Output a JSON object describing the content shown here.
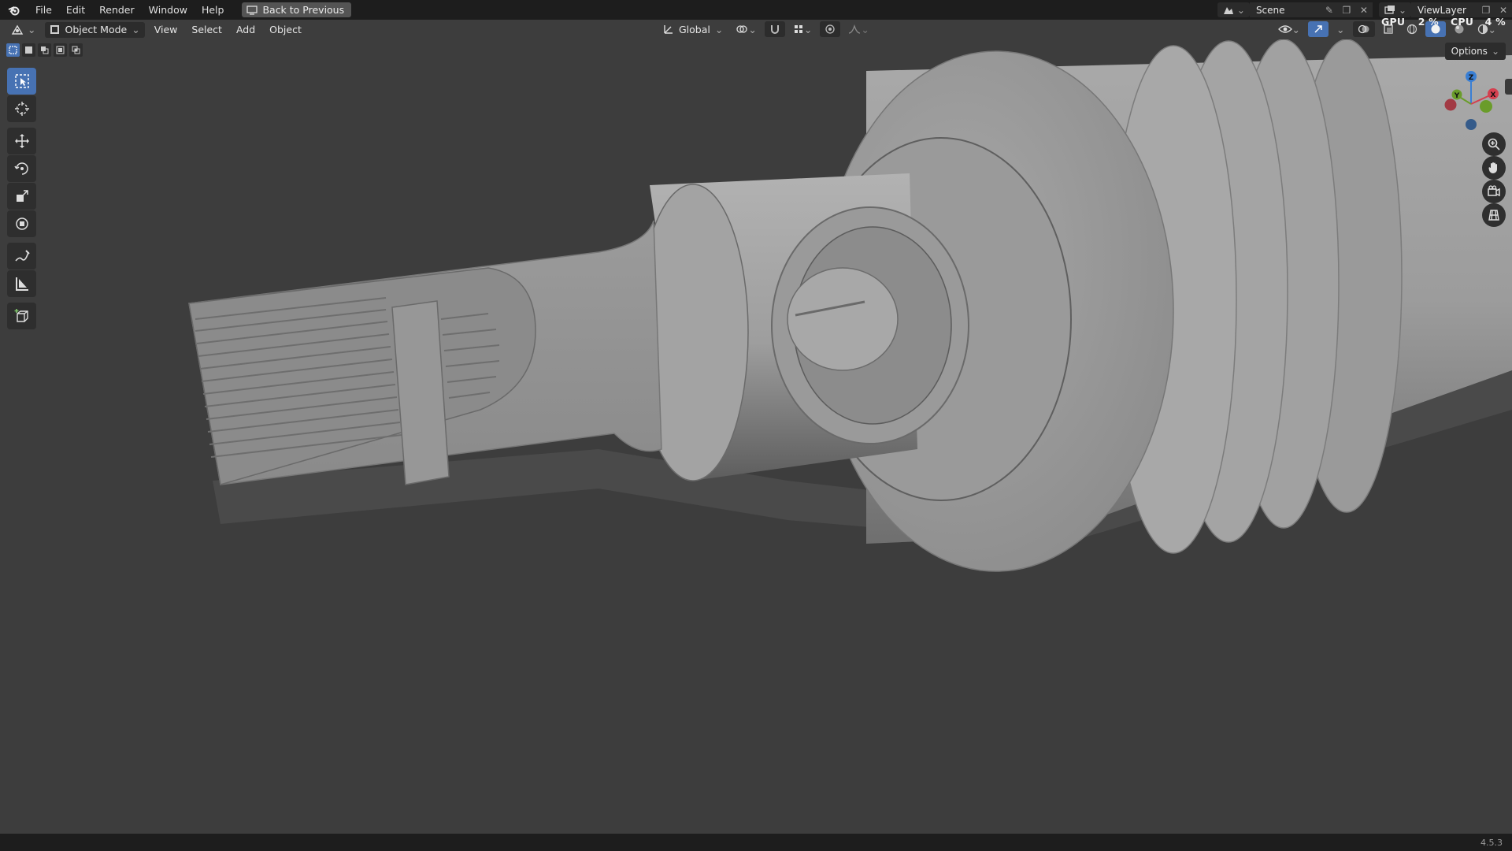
{
  "menu": {
    "items": [
      "File",
      "Edit",
      "Render",
      "Window",
      "Help"
    ],
    "back_label": "Back to Previous"
  },
  "scene": {
    "scene_name": "Scene",
    "view_layer": "ViewLayer"
  },
  "header": {
    "mode": "Object Mode",
    "menus": [
      "View",
      "Select",
      "Add",
      "Object"
    ],
    "orientation": "Global"
  },
  "perf": {
    "gpu_label": "GPU",
    "gpu_value": "2 %",
    "cpu_label": "CPU",
    "cpu_value": "4 %"
  },
  "options_label": "Options",
  "gizmo": {
    "x": "X",
    "y": "Y",
    "z": "Z"
  },
  "status": {
    "version": "4.5.3"
  },
  "colors": {
    "accent": "#4772b3",
    "axis_x": "#d4404f",
    "axis_y": "#6a9c2a",
    "axis_z": "#3a7fd4"
  }
}
